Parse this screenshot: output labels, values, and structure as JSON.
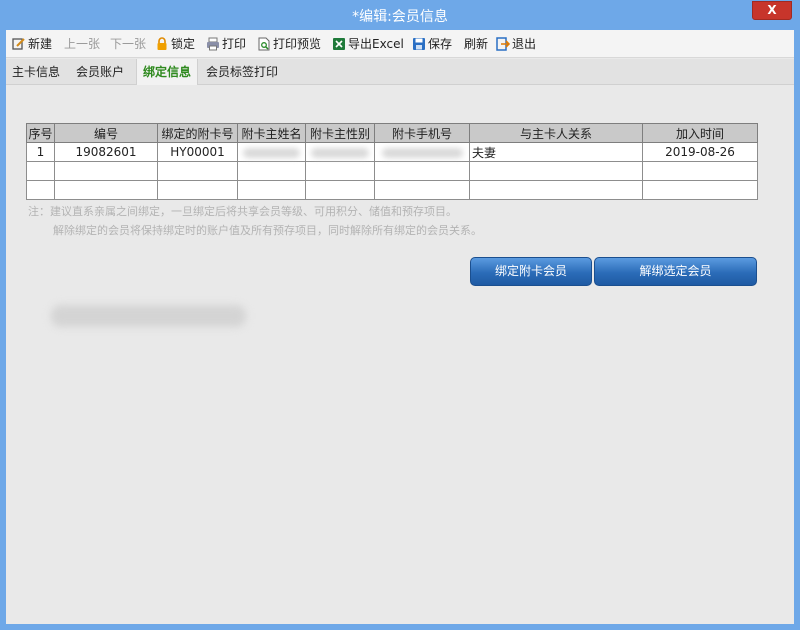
{
  "window": {
    "title": "*编辑:会员信息",
    "close_label": "X"
  },
  "toolbar": {
    "new": "新建",
    "prev": "上一张",
    "next": "下一张",
    "lock": "锁定",
    "print": "打印",
    "print_preview": "打印预览",
    "export_excel": "导出Excel",
    "save": "保存",
    "refresh": "刷新",
    "exit": "退出"
  },
  "tabs": [
    "主卡信息",
    "会员账户",
    "绑定信息",
    "会员标签打印"
  ],
  "active_tab": "绑定信息",
  "table": {
    "headers": [
      "序号",
      "编号",
      "绑定的附卡号",
      "附卡主姓名",
      "附卡主性别",
      "附卡手机号",
      "与主卡人关系",
      "加入时间"
    ],
    "rows": [
      {
        "index": "1",
        "number": "19082601",
        "card": "HY00001",
        "relation": "夫妻",
        "join_time": "2019-08-26"
      }
    ]
  },
  "note": {
    "line1": "注：建议直系亲属之间绑定，一旦绑定后将共享会员等级、可用积分、储值和预存项目。",
    "line2": "解除绑定的会员将保持绑定时的账户值及所有预存项目，同时解除所有绑定的会员关系。"
  },
  "buttons": {
    "bind": "绑定附卡会员",
    "unbind": "解绑选定会员"
  },
  "colors": {
    "title_bar": "#6ea8e8",
    "close": "#c7352b",
    "active_tab_text": "#2f8a1f",
    "button": "#2b6cb8"
  }
}
